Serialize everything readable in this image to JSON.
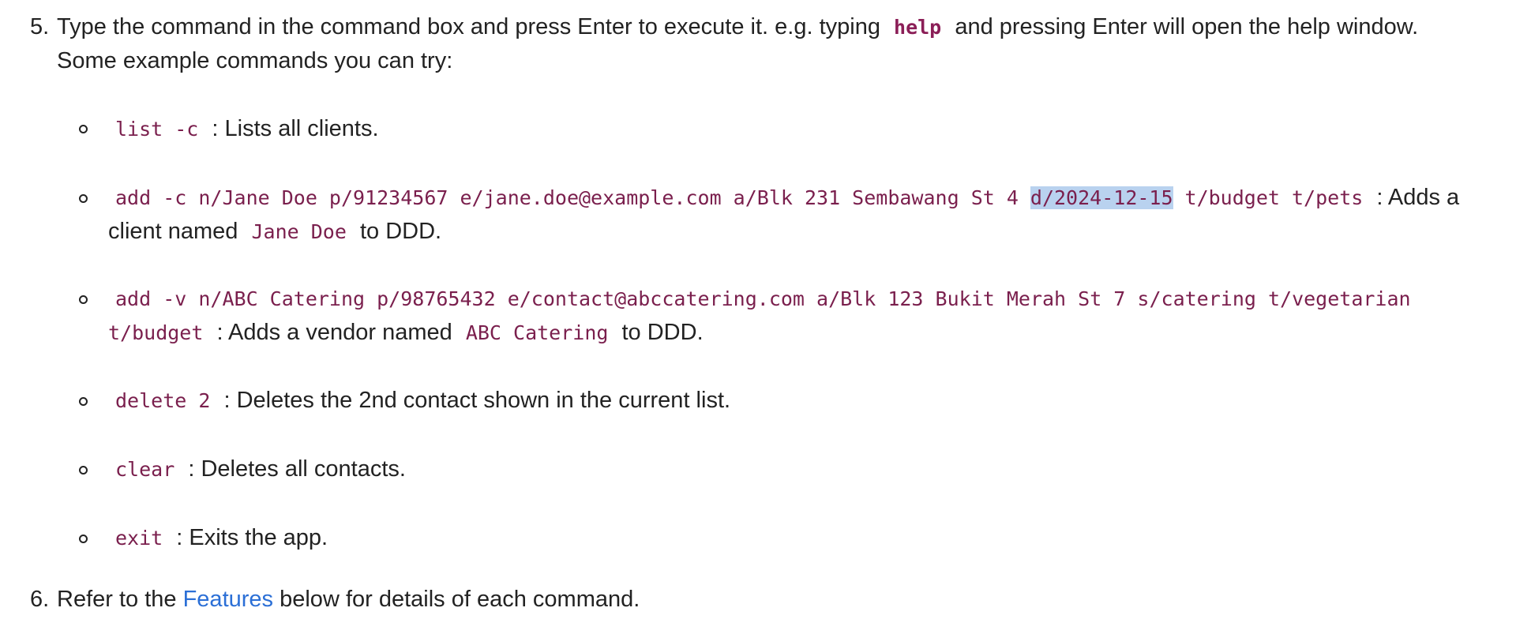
{
  "step5": {
    "number": "5.",
    "text_before": "Type the command in the command box and press Enter to execute it. e.g. typing",
    "code": "help",
    "text_after": "and pressing Enter will open the help window.",
    "line2": "Some example commands you can try:"
  },
  "examples": [
    {
      "code": "list -c",
      "desc": ": Lists all clients."
    },
    {
      "code_before": "add -c n/Jane Doe p/91234567 e/jane.doe@example.com a/Blk 231 Sembawang St 4",
      "code_highlight": "d/2024-12-15",
      "code_after": "t/budget t/pets",
      "desc_before": ": Adds a",
      "desc_line2": "client named",
      "name_code": "Jane Doe",
      "desc_end": "to DDD."
    },
    {
      "code": "add -v n/ABC Catering p/98765432 e/contact@abccatering.com a/Blk 123 Bukit Merah St 7 s/catering t/vegetarian",
      "code_line2": "t/budget",
      "desc_before": ": Adds a vendor named",
      "name_code": "ABC Catering",
      "desc_end": "to DDD."
    },
    {
      "code": "delete 2",
      "desc": ": Deletes the 2nd contact shown in the current list."
    },
    {
      "code": "clear",
      "desc": ": Deletes all contacts."
    },
    {
      "code": "exit",
      "desc": ": Exits the app."
    }
  ],
  "step6": {
    "number": "6.",
    "text_before": "Refer to the",
    "link": "Features",
    "text_after": "below for details of each command."
  },
  "colors": {
    "code": "#7a1f4d",
    "link": "#2b6fd6",
    "selection": "#b9d2ef"
  }
}
